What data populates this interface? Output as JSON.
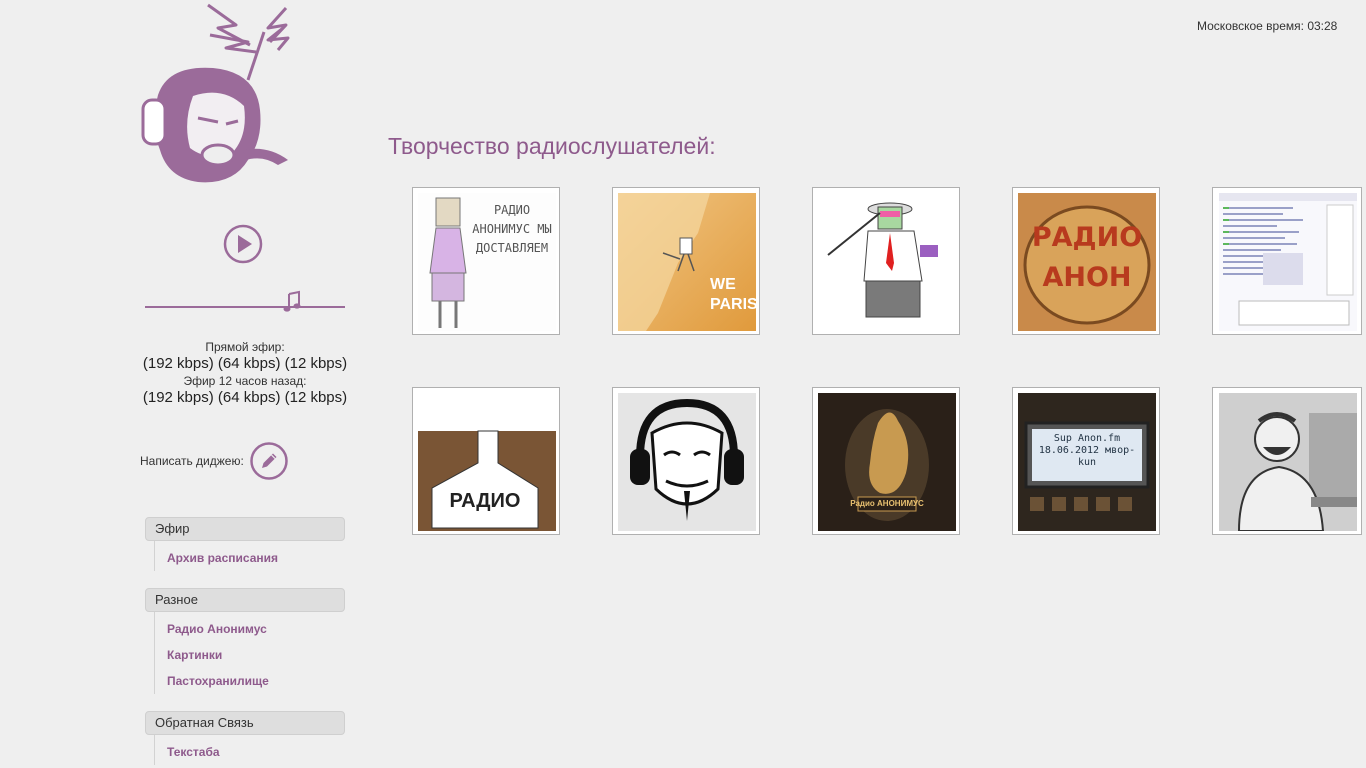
{
  "clock": {
    "label": "Московское время:",
    "time": "03:28"
  },
  "player": {
    "live_label": "Прямой эфир:",
    "live_streams": [
      "(192 kbps)",
      "(64 kbps)",
      "(12 kbps)"
    ],
    "past_label": "Эфир 12 часов назад:",
    "past_streams": [
      "(192 kbps)",
      "(64 kbps)",
      "(12 kbps)"
    ],
    "volume_level": 0.74
  },
  "dj": {
    "label": "Написать диджею:"
  },
  "menu": [
    {
      "header": "Эфир",
      "items": [
        "Архив расписания"
      ]
    },
    {
      "header": "Разное",
      "items": [
        "Радио Анонимус",
        "Картинки",
        "Пастохранилище"
      ]
    },
    {
      "header": "Обратная Связь",
      "items": [
        "Текстаба"
      ]
    }
  ],
  "gallery": {
    "heading": "Творчество радиослушателей:",
    "items": [
      {
        "name": "art-radio-anonymous-paper",
        "text": "РАДИО АНОНИМУС МЫ ДОСТАВЛЯЕМ"
      },
      {
        "name": "art-we-paris",
        "text": "WE PARIS"
      },
      {
        "name": "art-golfer-robot",
        "text": ""
      },
      {
        "name": "art-radio-anon-pancake",
        "text": "РАДИО АНОН"
      },
      {
        "name": "art-chat-screenshot",
        "text": ""
      },
      {
        "name": "art-radio-bottle",
        "text": "РАДИО"
      },
      {
        "name": "art-guy-fawkes-headphones",
        "text": ""
      },
      {
        "name": "art-rooster-emblem",
        "text": "Радио АНОНИМУС"
      },
      {
        "name": "art-lcd-display",
        "text": "Sup Anon.fm 18.06.2012 мвор-kun"
      },
      {
        "name": "art-laughing-man",
        "text": ""
      }
    ]
  },
  "colors": {
    "accent": "#8e5a8c",
    "background": "#efefef"
  }
}
